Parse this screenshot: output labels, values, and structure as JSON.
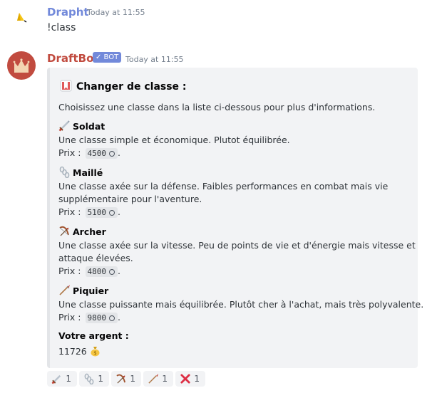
{
  "messages": [
    {
      "author": "Drapht",
      "author_color": "#7289da",
      "timestamp": "Today at 11:55",
      "content": "!class",
      "avatar_icon": "yellow-wedge-icon"
    },
    {
      "author": "DraftBot",
      "author_color": "#c14b3f",
      "bot_tag": "✓ BOT",
      "timestamp": "Today at 11:55",
      "avatar_icon": "crown-icon",
      "embed": {
        "title": "Changer de classe :",
        "title_icon": "bookmark-icon",
        "intro": "Choisissez une classe dans la liste ci-dessous pour plus d'informations.",
        "price_prefix": "Prix :",
        "price_suffix": ".",
        "classes": [
          {
            "name": "Soldat",
            "icon": "dagger-icon",
            "description_lines": [
              "Une classe simple et économique. Plutot équilibrée."
            ],
            "price": "4500"
          },
          {
            "name": "Maillé",
            "icon": "chains-icon",
            "description_lines": [
              "Une classe axée sur la défense. Faibles performances en combat mais vie",
              "supplémentaire pour l'aventure."
            ],
            "price": "5100"
          },
          {
            "name": "Archer",
            "icon": "bow-and-arrow-icon",
            "description_lines": [
              "Une classe axée sur la vitesse. Peu de points de vie et d'énergie mais vitesse et",
              "attaque élevées."
            ],
            "price": "4800"
          },
          {
            "name": "Piquier",
            "icon": "pike-icon",
            "description_lines": [
              "Une classe puissante mais équilibrée. Plutôt cher à l'achat, mais très polyvalente."
            ],
            "price": "9800"
          }
        ],
        "money_label": "Votre argent :",
        "money_value": "11726",
        "money_icon": "money-bag-icon"
      }
    }
  ],
  "reactions": [
    {
      "icon": "dagger-icon",
      "count": "1"
    },
    {
      "icon": "chains-icon",
      "count": "1"
    },
    {
      "icon": "bow-and-arrow-icon",
      "count": "1"
    },
    {
      "icon": "pike-icon",
      "count": "1"
    },
    {
      "icon": "cross-mark-icon",
      "count": "1"
    }
  ]
}
